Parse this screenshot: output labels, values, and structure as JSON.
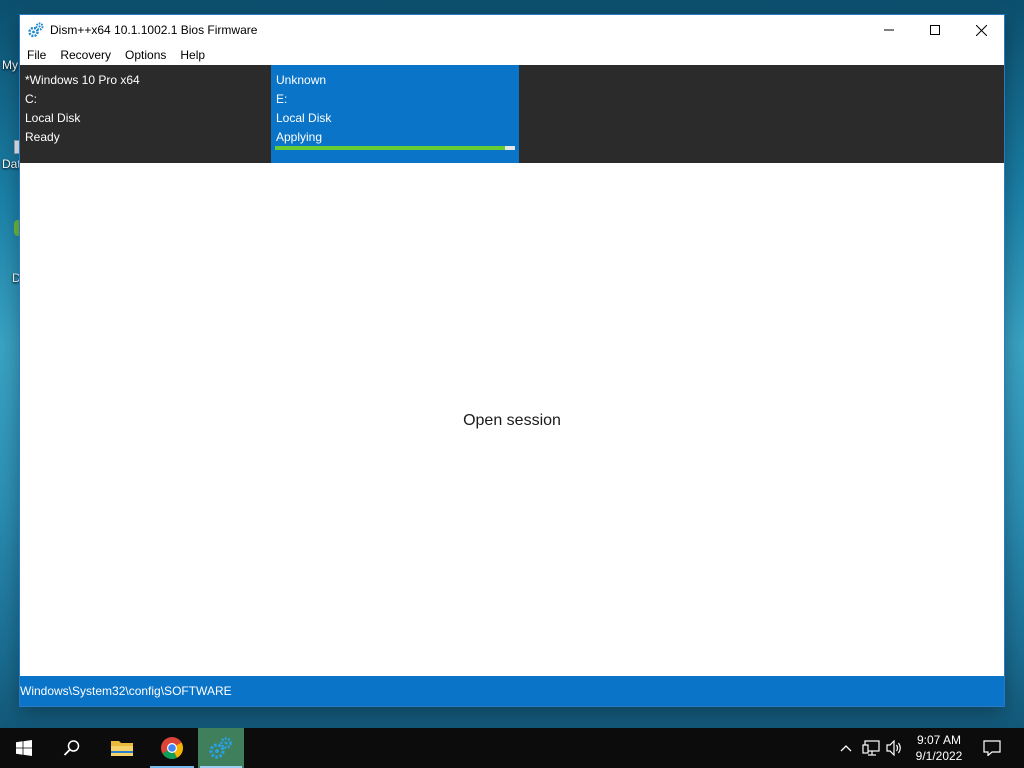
{
  "desktop": {
    "labels": [
      "My",
      "Dat",
      "D"
    ]
  },
  "window": {
    "title": "Dism++x64 10.1.1002.1 Bios Firmware",
    "menu": [
      "File",
      "Recovery",
      "Options",
      "Help"
    ],
    "sessions": [
      {
        "name": "*Windows 10 Pro x64",
        "drive": "C:",
        "type": "Local Disk",
        "status": "Ready",
        "selected": false
      },
      {
        "name": "Unknown",
        "drive": "E:",
        "type": "Local Disk",
        "status": "Applying",
        "selected": true,
        "progress": 0.96
      }
    ],
    "message": "Open session",
    "status_path": "Windows\\System32\\config\\SOFTWARE"
  },
  "taskbar": {
    "apps": [
      "start-icon",
      "search-icon",
      "file-explorer-icon",
      "chrome-icon",
      "dism-icon"
    ],
    "time": "9:07 AM",
    "date": "9/1/2022"
  },
  "colors": {
    "accent_blue": "#0a74c8",
    "progress_green": "#66cc33",
    "dark_panel": "#2b2b2b"
  }
}
